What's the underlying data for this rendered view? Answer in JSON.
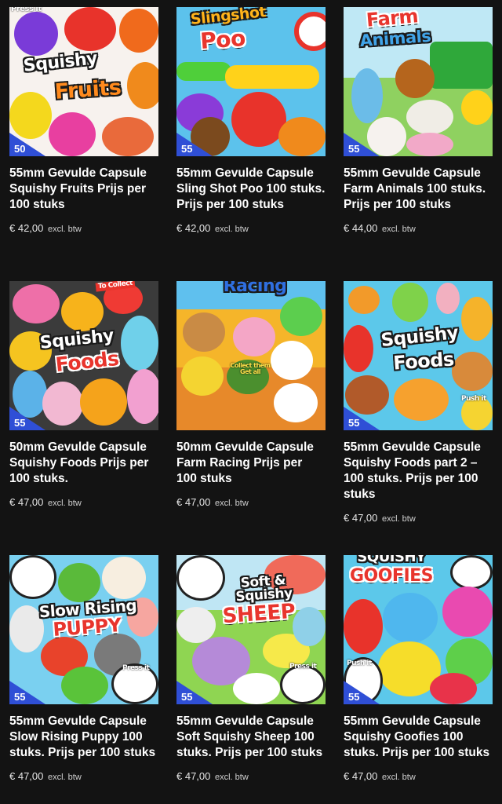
{
  "products": [
    {
      "image_caption": "Squishy Fruits",
      "image_number": "50",
      "image_extra": "Press it",
      "name": "55mm Gevulde Capsule Squishy Fruits Prijs per 100 stuks",
      "price": "€ 42,00",
      "tax_note": "excl. btw"
    },
    {
      "image_caption": "Slingshot Poo",
      "image_number": "55",
      "image_extra": "",
      "name": "55mm Gevulde Capsule Sling Shot Poo 100 stuks. Prijs per 100 stuks",
      "price": "€ 42,00",
      "tax_note": "excl. btw"
    },
    {
      "image_caption": "Farm Animals",
      "image_number": "55",
      "image_extra": "",
      "name": "55mm Gevulde Capsule Farm Animals 100 stuks. Prijs per 100 stuks",
      "price": "€ 44,00",
      "tax_note": "excl. btw"
    },
    {
      "image_caption": "Squishy Foods",
      "image_number": "55",
      "image_extra": "To Collect",
      "name": "50mm Gevulde Capsule Squishy Foods Prijs per 100 stuks.",
      "price": "€ 47,00",
      "tax_note": "excl. btw"
    },
    {
      "image_caption": "Racing",
      "image_number": "",
      "image_extra": "Collect them Get all",
      "name": "50mm Gevulde Capsule Farm Racing Prijs per 100 stuks",
      "price": "€ 47,00",
      "tax_note": "excl. btw"
    },
    {
      "image_caption": "Squishy Foods",
      "image_number": "55",
      "image_extra": "Push it",
      "name": "55mm Gevulde Capsule Squishy Foods part 2 – 100 stuks. Prijs per 100 stuks",
      "price": "€ 47,00",
      "tax_note": "excl. btw"
    },
    {
      "image_caption": "Slow Rising Puppy",
      "image_number": "55",
      "image_extra": "Press it",
      "name": "55mm Gevulde Capsule Slow Rising Puppy 100 stuks. Prijs per 100 stuks",
      "price": "€ 47,00",
      "tax_note": "excl. btw"
    },
    {
      "image_caption": "Soft & Squishy Sheep",
      "image_number": "55",
      "image_extra": "Press it",
      "name": "55mm Gevulde Capsule Soft Squishy Sheep 100 stuks. Prijs per 100 stuks",
      "price": "€ 47,00",
      "tax_note": "excl. btw"
    },
    {
      "image_caption": "Squishy Goofies",
      "image_number": "55",
      "image_extra": "Push it",
      "name": "55mm Gevulde Capsule Squishy Goofies 100 stuks. Prijs per 100 stuks",
      "price": "€ 47,00",
      "tax_note": "excl. btw"
    }
  ],
  "colors": {
    "background": "#131313",
    "text": "#ffffff",
    "badge_blue": "#2f4fd6"
  }
}
